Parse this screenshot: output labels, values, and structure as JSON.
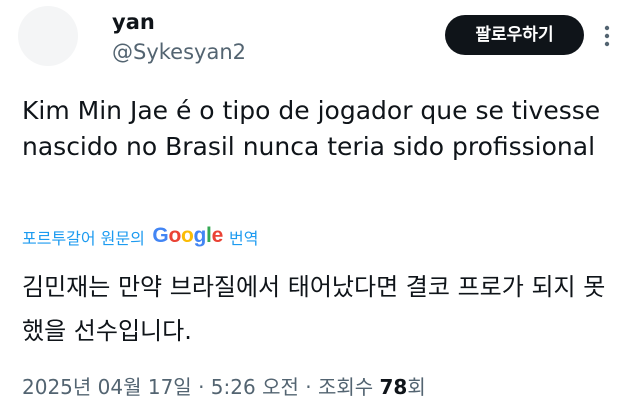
{
  "user": {
    "display_name": "yan",
    "handle": "@Sykesyan2"
  },
  "follow_button": {
    "label": "팔로우하기"
  },
  "more_icon": "more-vertical-dots-icon",
  "tweet": {
    "text": "Kim Min Jae é o tipo de jogador que se tivesse nascido no Brasil nunca teria sido profissional"
  },
  "translation": {
    "prefix": "포르투갈어 원문의",
    "provider": "Google",
    "action": "번역",
    "text": "김민재는 만약 브라질에서 태어났다면 결코 프로가 되지 못했을 선수입니다."
  },
  "meta": {
    "date": "2025년 04월 17일",
    "separator1": " · ",
    "time": "5:26 오전",
    "separator2": " · ",
    "views_label": "조회수 ",
    "views_count": "78",
    "views_suffix": "회"
  },
  "colors": {
    "text_primary": "#0f1419",
    "text_secondary": "#536471",
    "link": "#1d9bf0",
    "button_bg": "#0f1419"
  }
}
